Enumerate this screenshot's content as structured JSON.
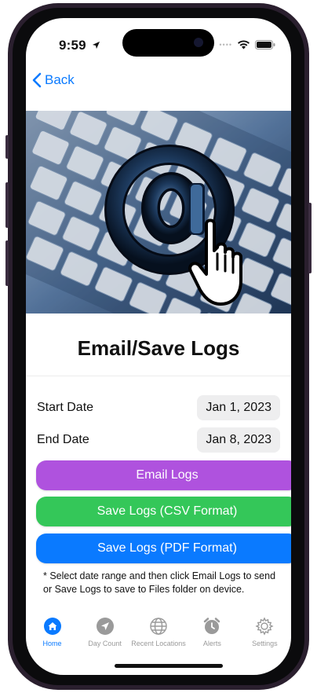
{
  "status_bar": {
    "time": "9:59"
  },
  "nav": {
    "back_label": "Back"
  },
  "page": {
    "title": "Email/Save Logs"
  },
  "form": {
    "start_label": "Start Date",
    "start_value": "Jan 1, 2023",
    "end_label": "End Date",
    "end_value": "Jan 8, 2023"
  },
  "actions": {
    "email_label": "Email Logs",
    "csv_label": "Save Logs (CSV Format)",
    "pdf_label": "Save Logs (PDF Format)"
  },
  "note": "* Select date range and then click Email Logs to send or Save Logs to save to Files folder on device.",
  "tabbar": {
    "items": [
      {
        "label": "Home",
        "icon": "house-icon",
        "active": true
      },
      {
        "label": "Day Count",
        "icon": "location-arrow-icon",
        "active": false
      },
      {
        "label": "Recent Locations",
        "icon": "globe-icon",
        "active": false
      },
      {
        "label": "Alerts",
        "icon": "alarm-icon",
        "active": false
      },
      {
        "label": "Settings",
        "icon": "gear-icon",
        "active": false
      }
    ]
  },
  "colors": {
    "accent": "#0a7aff",
    "email_button": "#af52de",
    "csv_button": "#34c759",
    "pdf_button": "#0a7aff"
  }
}
